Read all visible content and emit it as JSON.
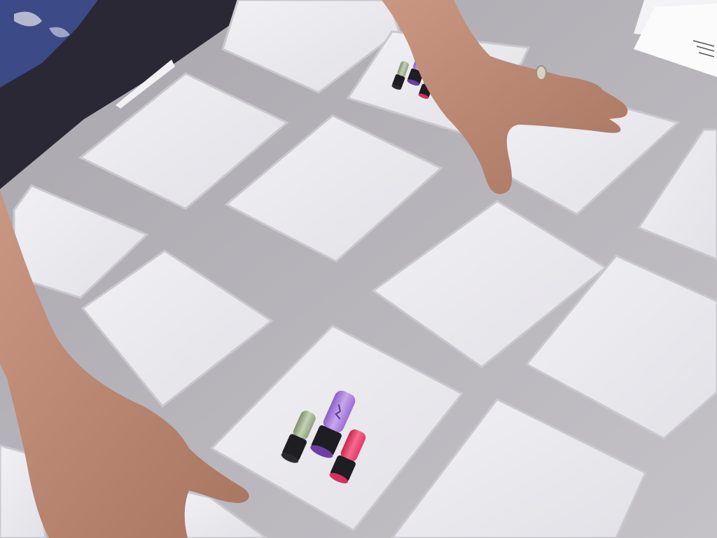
{
  "scene": {
    "description_type": "photo",
    "table_color": "#bdbbc0",
    "card_color": "#e9e8ed",
    "card_edge_color": "#c9c8ce",
    "skin_color": "#b88670",
    "sleeve_color": "#2a2834"
  },
  "cards": {
    "face_down_count": 15,
    "face_up": [
      {
        "id": "card-face-up-large",
        "image": "bottles-icon",
        "colors": [
          "#8fa07e",
          "#9b6fd0",
          "#e03a6a"
        ]
      },
      {
        "id": "card-face-up-small",
        "image": "bottles-icon",
        "colors": [
          "#8fa07e",
          "#9b6fd0",
          "#e03a6a"
        ]
      }
    ]
  }
}
